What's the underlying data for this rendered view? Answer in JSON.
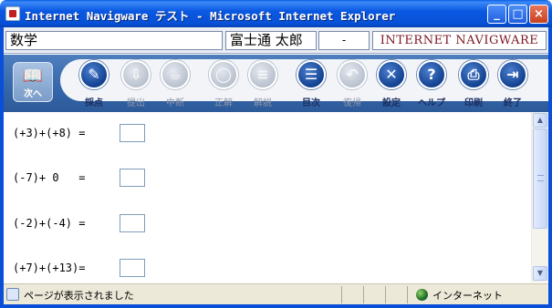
{
  "window": {
    "title": "Internet Navigware テスト - Microsoft Internet Explorer",
    "minimize_icon": "minimize-icon",
    "maximize_icon": "maximize-icon",
    "close_icon": "close-icon"
  },
  "header": {
    "subject": "数学",
    "user_name": "富士通 太郎",
    "separator": "-",
    "logo": "INTERNET NAVIGWARE",
    "colors": {
      "logo": "#7a1420"
    }
  },
  "toolbar": {
    "next_button": {
      "label": "次へ",
      "icon": "book-next-icon"
    },
    "tools": [
      {
        "label": "採点",
        "icon": "grade-icon",
        "enabled": true
      },
      {
        "label": "提出",
        "icon": "submit-icon",
        "enabled": false
      },
      {
        "label": "中断",
        "icon": "pause-icon",
        "enabled": false
      },
      {
        "label": "正解",
        "icon": "correct-icon",
        "enabled": false
      },
      {
        "label": "解説",
        "icon": "explanation-icon",
        "enabled": false
      },
      {
        "label": "目次",
        "icon": "contents-icon",
        "enabled": true
      },
      {
        "label": "復帰",
        "icon": "return-icon",
        "enabled": false
      },
      {
        "label": "設定",
        "icon": "settings-icon",
        "enabled": true
      },
      {
        "label": "ヘルプ",
        "icon": "help-icon",
        "enabled": true
      },
      {
        "label": "印刷",
        "icon": "print-icon",
        "enabled": true
      },
      {
        "label": "終了",
        "icon": "exit-icon",
        "enabled": true
      }
    ],
    "colors": {
      "accent": "#11418f",
      "bar": "#3466aa"
    }
  },
  "problems": [
    {
      "expression": "(+3)+(+8) =",
      "answer": ""
    },
    {
      "expression": "(-7)+ 0   =",
      "answer": ""
    },
    {
      "expression": "(-2)+(-4) =",
      "answer": ""
    },
    {
      "expression": "(+7)+(+13)=",
      "answer": ""
    }
  ],
  "statusbar": {
    "status_text": "ページが表示されました",
    "zone_text": "インターネット"
  }
}
